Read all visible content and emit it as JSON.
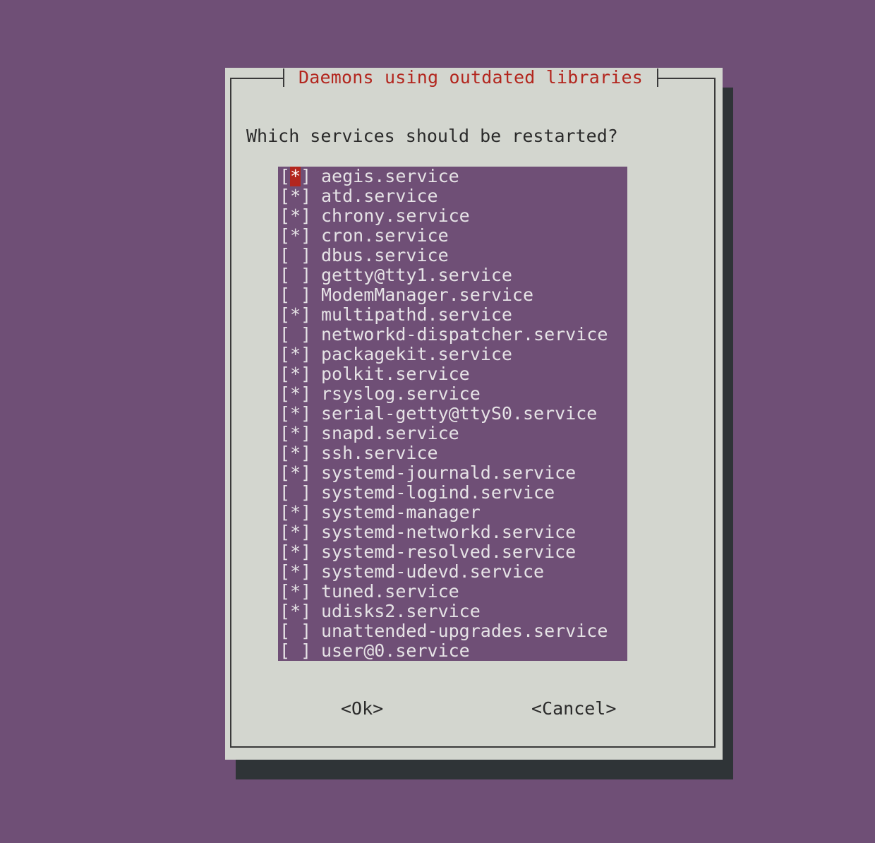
{
  "dialog": {
    "title": "Daemons using outdated libraries",
    "prompt": "Which services should be restarted?",
    "ok_label": "<Ok>",
    "cancel_label": "<Cancel>"
  },
  "services": [
    {
      "checked": true,
      "mark": "*",
      "label": "aegis.service",
      "cursor": true
    },
    {
      "checked": true,
      "mark": "*",
      "label": "atd.service"
    },
    {
      "checked": true,
      "mark": "*",
      "label": "chrony.service"
    },
    {
      "checked": true,
      "mark": "*",
      "label": "cron.service"
    },
    {
      "checked": false,
      "mark": " ",
      "label": "dbus.service"
    },
    {
      "checked": false,
      "mark": " ",
      "label": "getty@tty1.service"
    },
    {
      "checked": false,
      "mark": " ",
      "label": "ModemManager.service"
    },
    {
      "checked": true,
      "mark": "*",
      "label": "multipathd.service"
    },
    {
      "checked": false,
      "mark": " ",
      "label": "networkd-dispatcher.service"
    },
    {
      "checked": true,
      "mark": "*",
      "label": "packagekit.service"
    },
    {
      "checked": true,
      "mark": "*",
      "label": "polkit.service"
    },
    {
      "checked": true,
      "mark": "*",
      "label": "rsyslog.service"
    },
    {
      "checked": true,
      "mark": "*",
      "label": "serial-getty@ttyS0.service"
    },
    {
      "checked": true,
      "mark": "*",
      "label": "snapd.service"
    },
    {
      "checked": true,
      "mark": "*",
      "label": "ssh.service"
    },
    {
      "checked": true,
      "mark": "*",
      "label": "systemd-journald.service"
    },
    {
      "checked": false,
      "mark": " ",
      "label": "systemd-logind.service"
    },
    {
      "checked": true,
      "mark": "*",
      "label": "systemd-manager"
    },
    {
      "checked": true,
      "mark": "*",
      "label": "systemd-networkd.service"
    },
    {
      "checked": true,
      "mark": "*",
      "label": "systemd-resolved.service"
    },
    {
      "checked": true,
      "mark": "*",
      "label": "systemd-udevd.service"
    },
    {
      "checked": true,
      "mark": "*",
      "label": "tuned.service"
    },
    {
      "checked": true,
      "mark": "*",
      "label": "udisks2.service"
    },
    {
      "checked": false,
      "mark": " ",
      "label": "unattended-upgrades.service"
    },
    {
      "checked": false,
      "mark": " ",
      "label": "user@0.service"
    }
  ],
  "colors": {
    "background": "#6f4f76",
    "dialog": "#d3d6cf",
    "shadow": "#2f3437",
    "title": "#b3261e",
    "cursor": "#b3261e"
  }
}
